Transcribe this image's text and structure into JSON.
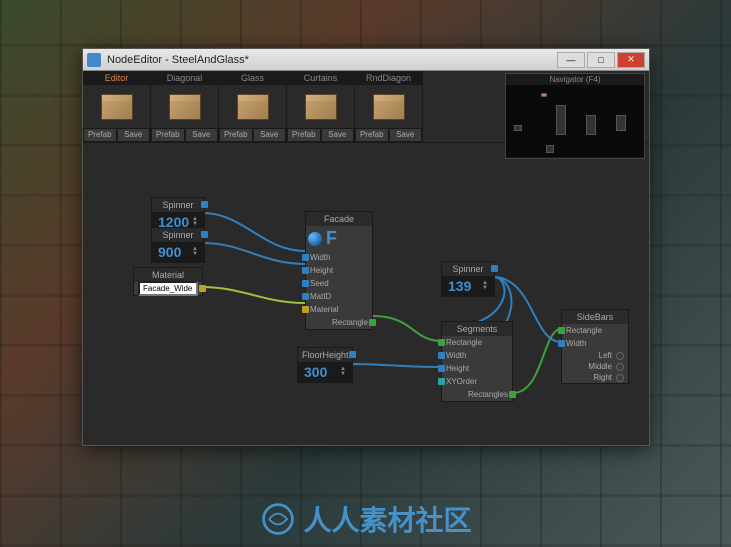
{
  "window": {
    "title": "NodeEditor - SteelAndGlass*"
  },
  "toolbar": {
    "groups": [
      {
        "tab": "Editor",
        "btn1": "Prefab",
        "btn2": "Save"
      },
      {
        "tab": "Diagonal",
        "btn1": "Prefab",
        "btn2": "Save"
      },
      {
        "tab": "Glass",
        "btn1": "Prefab",
        "btn2": "Save"
      },
      {
        "tab": "Curtains",
        "btn1": "Prefab",
        "btn2": "Save"
      },
      {
        "tab": "RndDiagon",
        "btn1": "Prefab",
        "btn2": "Save"
      }
    ]
  },
  "navigator": {
    "label": "Navigator (F4)"
  },
  "nodes": {
    "spinner1": {
      "title": "Spinner",
      "value": "1200"
    },
    "spinner2": {
      "title": "Spinner",
      "value": "900"
    },
    "material": {
      "title": "Material",
      "value": "Facade_Wide..."
    },
    "facade": {
      "title": "Facade",
      "ports": [
        "Width",
        "Height",
        "Seed",
        "MatID",
        "Material"
      ],
      "out": "Rectangle"
    },
    "floorheight": {
      "title": "FloorHeight",
      "value": "300"
    },
    "spinner3": {
      "title": "Spinner",
      "value": "139"
    },
    "segments": {
      "title": "Segments",
      "ports": [
        "Rectangle",
        "Width",
        "Height",
        "XYOrder"
      ],
      "out": "Rectangles"
    },
    "sidebars": {
      "title": "SideBars",
      "ports": [
        "Rectangle",
        "Width"
      ],
      "radios": [
        "Left",
        "Middle",
        "Right"
      ]
    }
  },
  "watermark": "人人素材社区"
}
